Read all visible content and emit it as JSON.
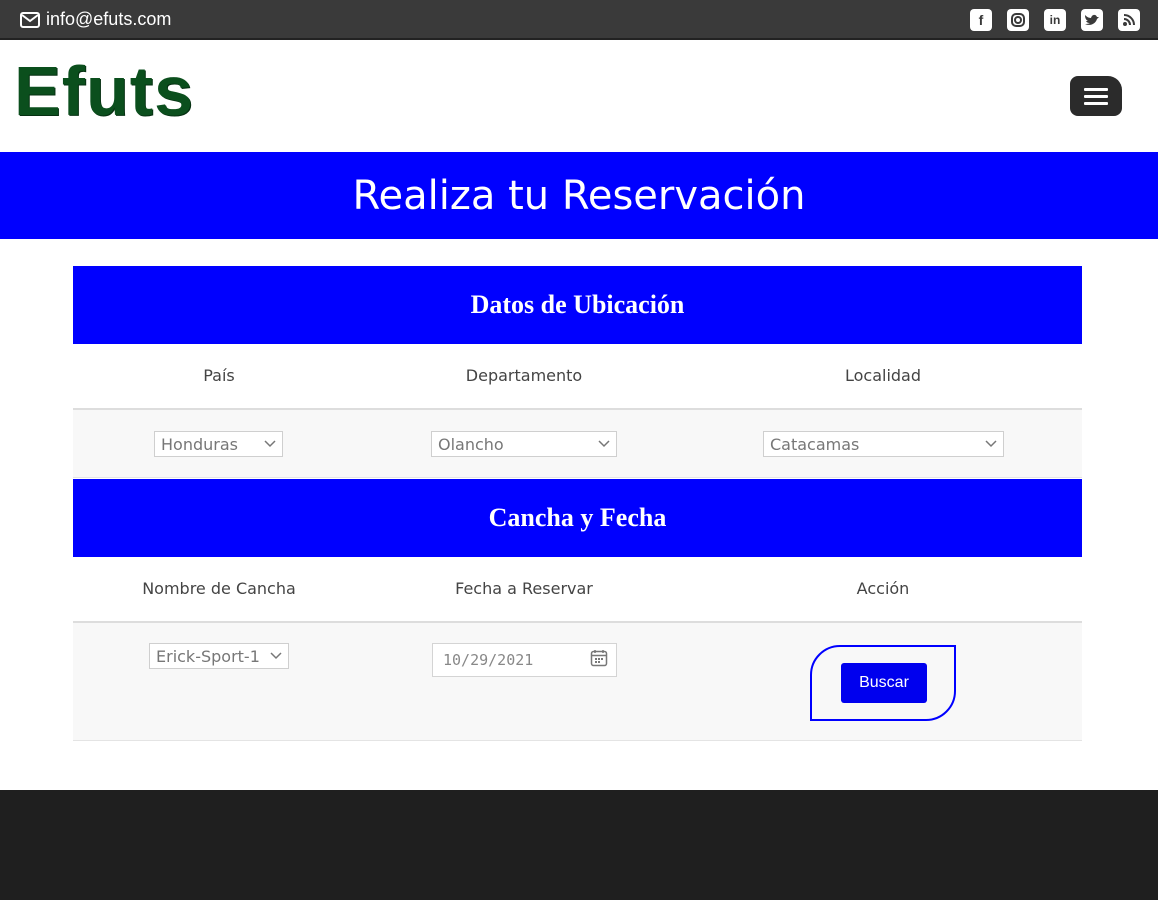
{
  "topbar": {
    "email": "info@efuts.com",
    "social_icons": [
      "facebook-icon",
      "instagram-icon",
      "linkedin-icon",
      "twitter-icon",
      "rss-icon"
    ]
  },
  "header": {
    "logo_text": "Efuts"
  },
  "banner": {
    "title": "Realiza tu Reservación"
  },
  "location_section": {
    "title": "Datos de Ubicación",
    "columns": [
      "País",
      "Departamento",
      "Localidad"
    ],
    "pais_value": "Honduras",
    "departamento_value": "Olancho",
    "localidad_value": "Catacamas"
  },
  "field_section": {
    "title": "Cancha y Fecha",
    "columns": [
      "Nombre de Cancha",
      "Fecha a Reservar",
      "Acción"
    ],
    "cancha_value": "Erick-Sport-1",
    "fecha_value": "10/29/2021",
    "search_button": "Buscar"
  },
  "colors": {
    "accent_blue": "#0000ff",
    "topbar_bg": "#3a3a3a",
    "logo_green": "#0b4f1d",
    "footer_bg": "#1f1f1f"
  }
}
